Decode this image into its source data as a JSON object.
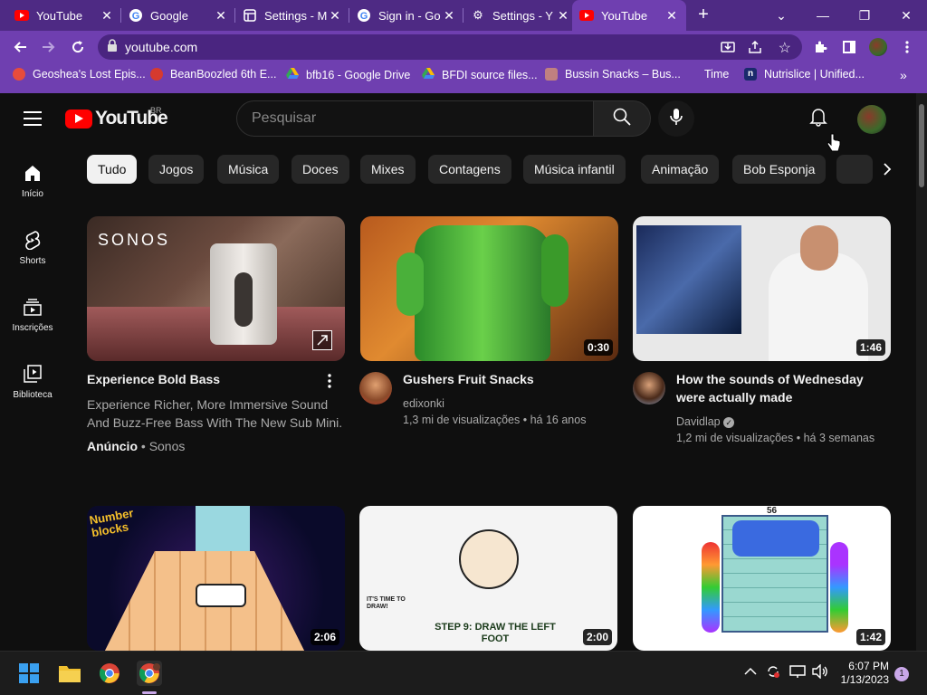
{
  "browser": {
    "tabs": [
      {
        "title": "YouTube",
        "icon": "youtube-icon"
      },
      {
        "title": "Google",
        "icon": "google-icon"
      },
      {
        "title": "Settings - M",
        "icon": "settings-doc-icon"
      },
      {
        "title": "Sign in - Go",
        "icon": "google-icon"
      },
      {
        "title": "Settings - Y",
        "icon": "gear-icon"
      },
      {
        "title": "YouTube",
        "icon": "youtube-icon",
        "active": true
      }
    ],
    "url": "youtube.com",
    "bookmarks": [
      {
        "label": "Geoshea's Lost Epis..."
      },
      {
        "label": "BeanBoozled 6th E..."
      },
      {
        "label": "bfb16 - Google Drive"
      },
      {
        "label": "BFDI source files..."
      },
      {
        "label": "Bussin Snacks – Bus..."
      },
      {
        "label": "Time"
      },
      {
        "label": "Nutrislice | Unified..."
      }
    ],
    "colors": {
      "frame": "#4e2a84",
      "toolbar": "#6f3fb0"
    }
  },
  "youtube": {
    "logo_text": "YouTube",
    "country_code": "BR",
    "search_placeholder": "Pesquisar",
    "sidebar": [
      {
        "label": "Início",
        "icon": "home-icon"
      },
      {
        "label": "Shorts",
        "icon": "shorts-icon"
      },
      {
        "label": "Inscrições",
        "icon": "subscriptions-icon"
      },
      {
        "label": "Biblioteca",
        "icon": "library-icon"
      }
    ],
    "chips": [
      "Tudo",
      "Jogos",
      "Música",
      "Doces",
      "Mixes",
      "Contagens",
      "Música infantil",
      "Animação",
      "Bob Esponja"
    ],
    "videos": [
      {
        "title": "Experience Bold Bass",
        "description": "Experience Richer, More Immersive Sound And Buzz-Free Bass With The New Sub Mini.",
        "ad_label": "Anúncio",
        "channel": "Sonos",
        "thumb_text": "SONOS"
      },
      {
        "title": "Gushers Fruit Snacks",
        "channel": "edixonki",
        "views": "1,3 mi de visualizações",
        "age": "há 16 anos",
        "duration": "0:30"
      },
      {
        "title": "How the sounds of Wednesday were actually made",
        "channel": "Davidlap",
        "views": "1,2 mi de visualizações",
        "age": "há 3 semanas",
        "duration": "1:46"
      },
      {
        "duration": "2:06",
        "thumb_text": "Number blocks"
      },
      {
        "duration": "2:00",
        "thumb_text": "STEP 9: DRAW THE LEFT FOOT",
        "thumb_small": "IT'S TIME TO DRAW!"
      },
      {
        "duration": "1:42",
        "thumb_text": "56"
      }
    ],
    "meta_separator": "•"
  },
  "taskbar": {
    "time": "6:07 PM",
    "date": "1/13/2023",
    "notification_count": "1"
  }
}
